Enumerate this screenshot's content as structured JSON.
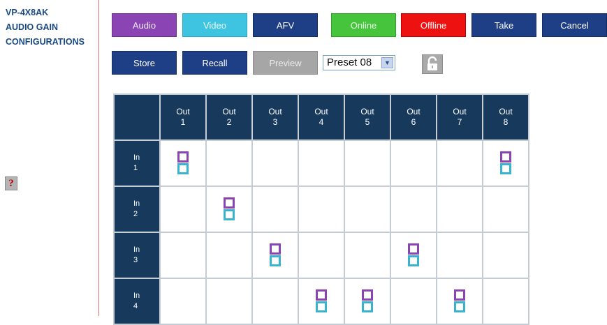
{
  "sidebar": {
    "title_lines": [
      "VP-4X8AK",
      "AUDIO GAIN",
      "CONFIGURATIONS"
    ],
    "help_label": "?"
  },
  "toolbar": {
    "audio": "Audio",
    "video": "Video",
    "afv": "AFV",
    "online": "Online",
    "offline": "Offline",
    "take": "Take",
    "cancel": "Cancel",
    "store": "Store",
    "recall": "Recall",
    "preview": "Preview"
  },
  "preset": {
    "selected": "Preset 08",
    "arrow": "▼"
  },
  "lock_icon": "unlock-icon",
  "matrix": {
    "outputs": [
      {
        "label": "Out",
        "num": "1"
      },
      {
        "label": "Out",
        "num": "2"
      },
      {
        "label": "Out",
        "num": "3"
      },
      {
        "label": "Out",
        "num": "4"
      },
      {
        "label": "Out",
        "num": "5"
      },
      {
        "label": "Out",
        "num": "6"
      },
      {
        "label": "Out",
        "num": "7"
      },
      {
        "label": "Out",
        "num": "8"
      }
    ],
    "inputs": [
      {
        "label": "In",
        "num": "1",
        "routes": [
          1,
          8
        ]
      },
      {
        "label": "In",
        "num": "2",
        "routes": [
          2
        ]
      },
      {
        "label": "In",
        "num": "3",
        "routes": [
          3,
          6
        ]
      },
      {
        "label": "In",
        "num": "4",
        "routes": [
          4,
          5,
          7
        ]
      }
    ]
  },
  "colors": {
    "audio": "#8a44b4",
    "video": "#3ec4e0",
    "online": "#45c43c",
    "offline": "#ee1111",
    "navy": "#1e3f86",
    "header": "#173a5c"
  }
}
